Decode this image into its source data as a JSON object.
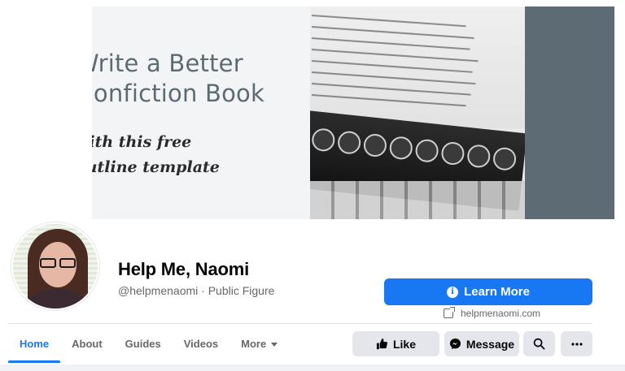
{
  "cover": {
    "headline_line1": "Write a Better",
    "headline_line2": "Nonfiction Book",
    "sub_line1": "with this free",
    "sub_line2": "outline template"
  },
  "profile": {
    "name": "Help Me, Naomi",
    "handle": "@helpmenaomi · Public Figure"
  },
  "cta": {
    "label": "Learn More",
    "website": "helpmenaomi.com"
  },
  "tabs": [
    {
      "label": "Home"
    },
    {
      "label": "About"
    },
    {
      "label": "Guides"
    },
    {
      "label": "Videos"
    },
    {
      "label": "More"
    }
  ],
  "actions": {
    "like": "Like",
    "message": "Message"
  },
  "colors": {
    "accent": "#1877f2",
    "button_bg": "#e4e6eb",
    "muted_text": "#65676b"
  }
}
